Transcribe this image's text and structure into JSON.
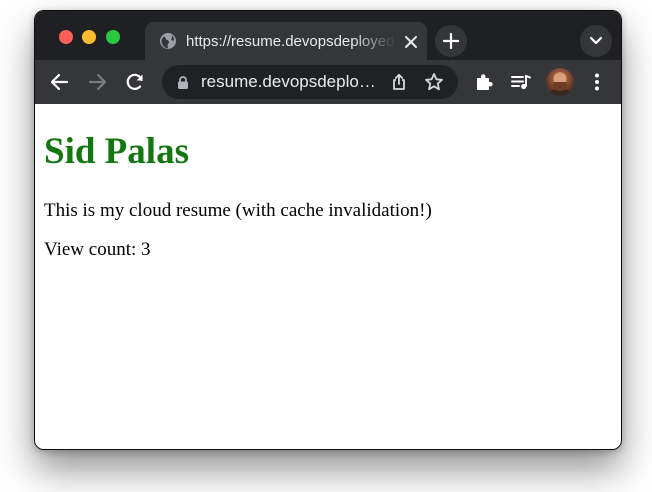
{
  "browser": {
    "tab": {
      "title": "https://resume.devopsdeployed.com",
      "favicon": "globe-icon"
    },
    "address_bar": {
      "url": "resume.devopsdeplo…"
    },
    "colors": {
      "titlebar": "#1f2023",
      "toolbar": "#35363a",
      "omnibox": "#202124",
      "traffic_close": "#fe5f57",
      "traffic_minimize": "#febc2e",
      "traffic_zoom": "#28c840"
    },
    "icons": [
      "back-arrow-icon",
      "forward-arrow-icon",
      "reload-icon",
      "lock-icon",
      "share-icon",
      "star-icon",
      "extensions-puzzle-icon",
      "media-queue-icon",
      "avatar",
      "menu-kebab-icon",
      "new-tab-plus-icon",
      "tab-search-chevron-icon",
      "close-icon"
    ]
  },
  "page": {
    "heading": "Sid Palas",
    "description": "This is my cloud resume (with cache invalidation!)",
    "view_count": "View count: 3",
    "colors": {
      "heading": "#137711",
      "text": "#000000",
      "background": "#ffffff"
    }
  }
}
